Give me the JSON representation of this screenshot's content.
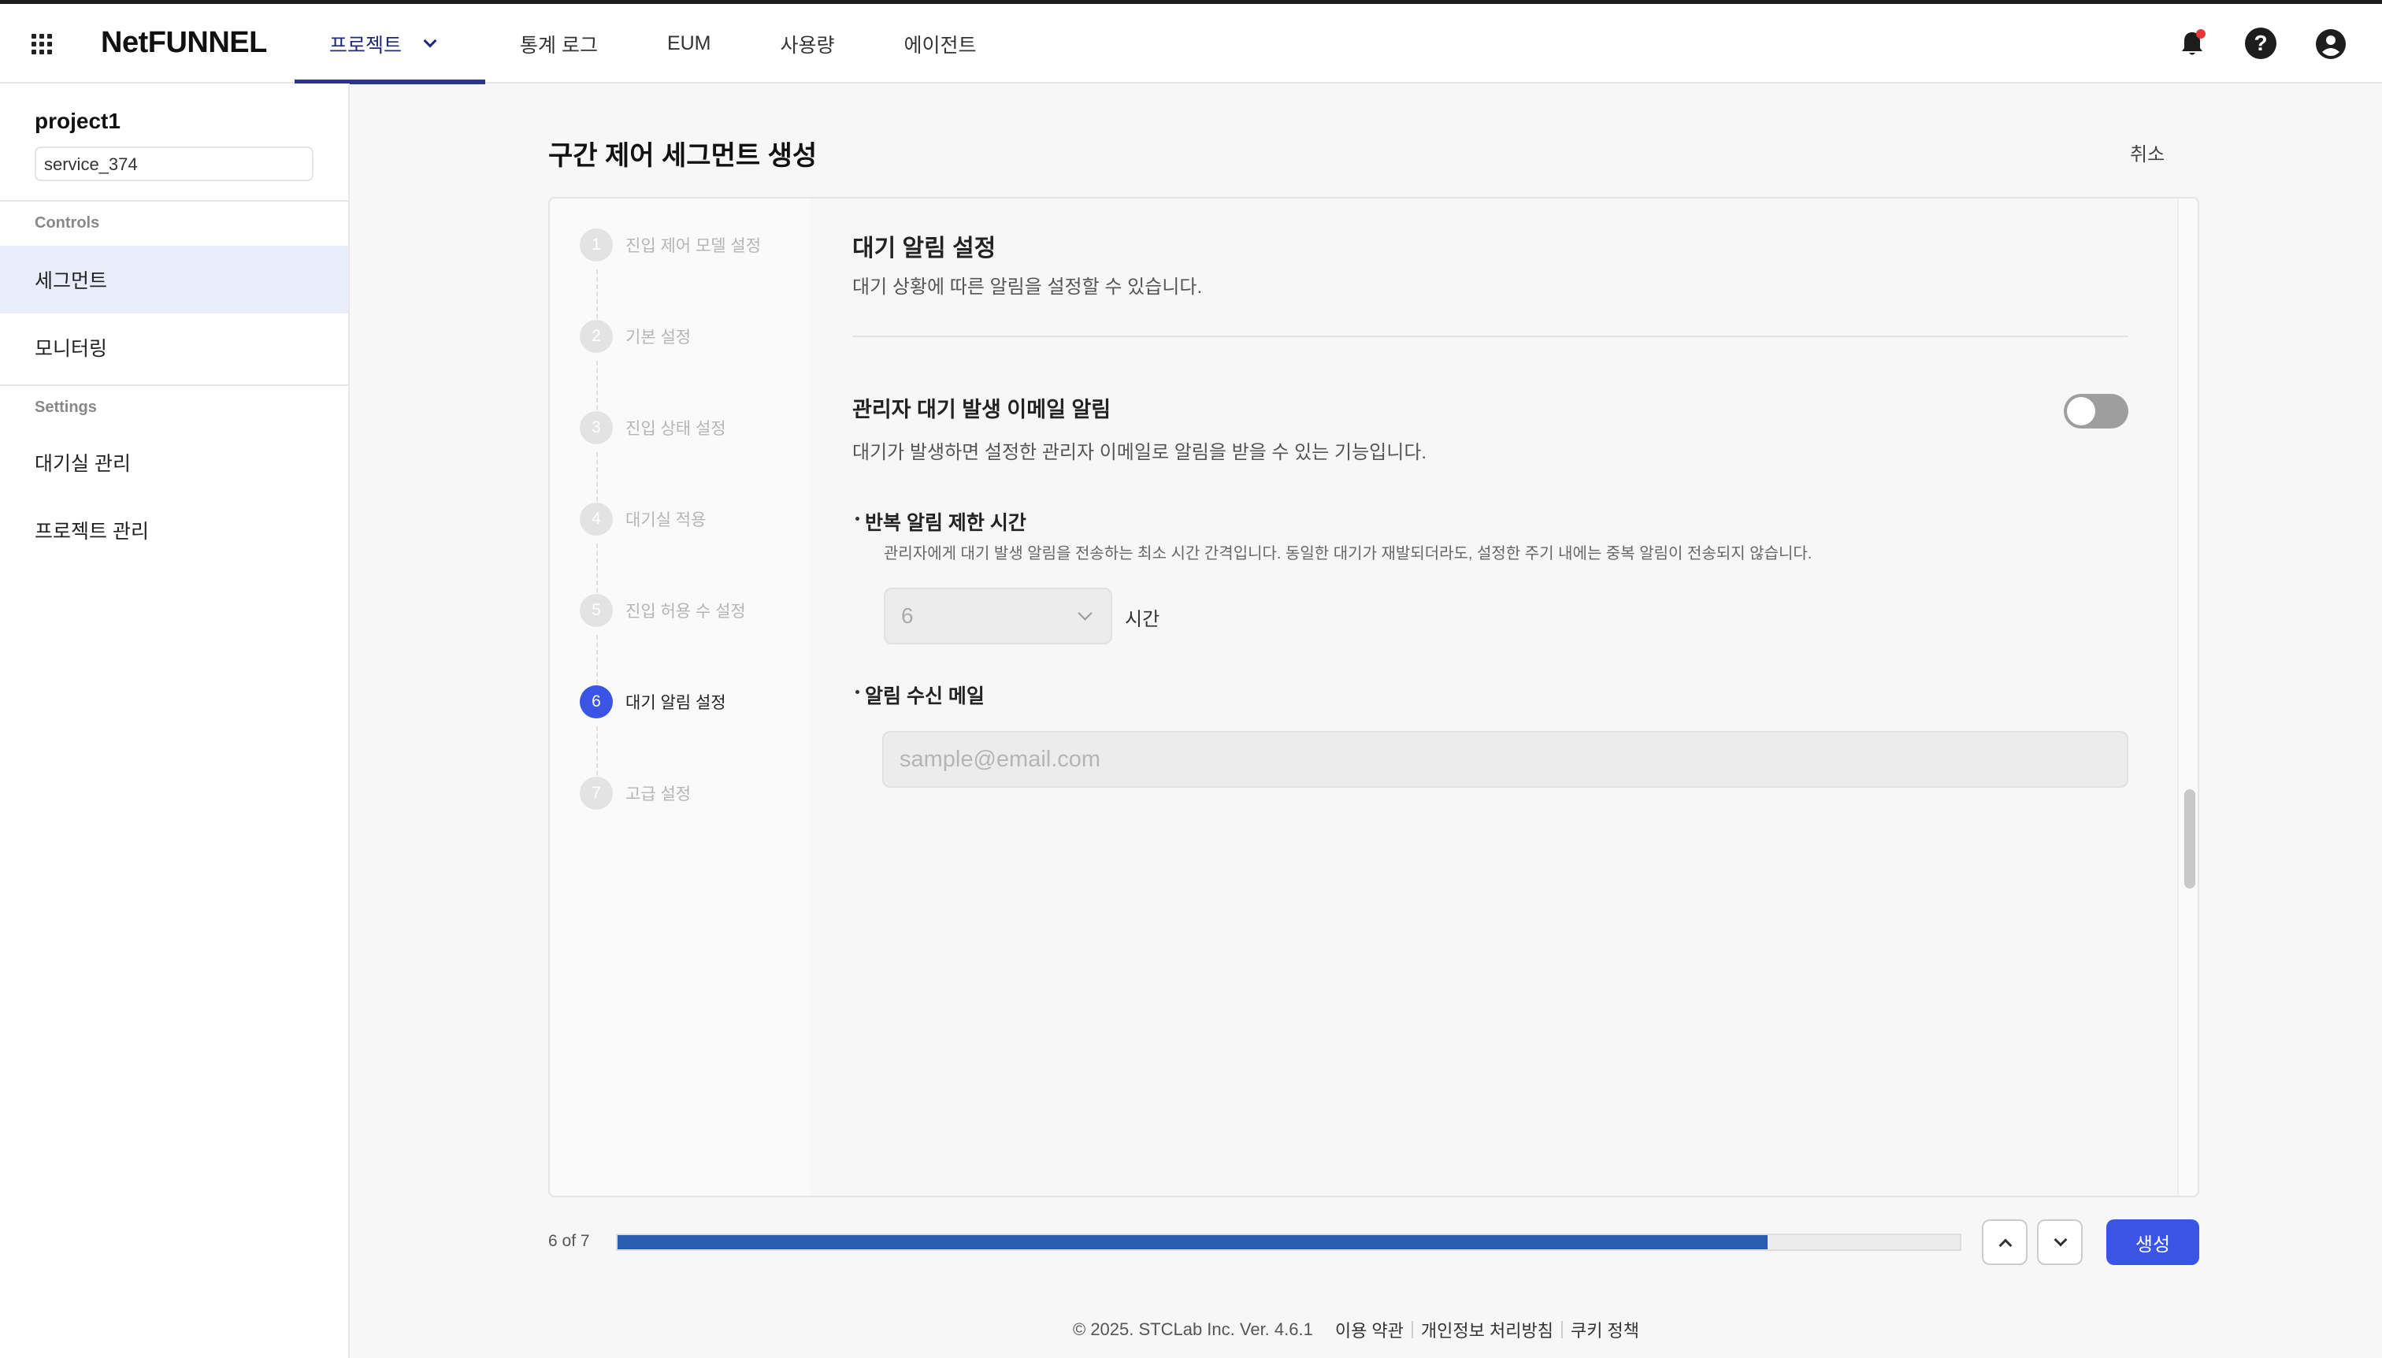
{
  "header": {
    "logo": "NetFUNNEL",
    "nav": [
      "프로젝트",
      "통계 로그",
      "EUM",
      "사용량",
      "에이전트"
    ],
    "active_nav": "프로젝트",
    "icons": [
      "apps-grid-icon",
      "bell-icon",
      "help-icon",
      "account-icon"
    ],
    "help_glyph": "?"
  },
  "sidebar": {
    "project": "project1",
    "service": "service_374",
    "controls_heading": "Controls",
    "controls": [
      "세그먼트",
      "모니터링"
    ],
    "settings_heading": "Settings",
    "settings": [
      "대기실 관리",
      "프로젝트 관리"
    ]
  },
  "page": {
    "title": "구간 제어 세그먼트 생성",
    "cancel": "취소"
  },
  "steps": [
    {
      "num": "1",
      "label": "진입 제어 모델 설정"
    },
    {
      "num": "2",
      "label": "기본 설정"
    },
    {
      "num": "3",
      "label": "진입 상태 설정"
    },
    {
      "num": "4",
      "label": "대기실 적용"
    },
    {
      "num": "5",
      "label": "진입 허용 수 설정"
    },
    {
      "num": "6",
      "label": "대기 알림 설정"
    },
    {
      "num": "7",
      "label": "고급 설정"
    }
  ],
  "active_step": 6,
  "section": {
    "title": "대기 알림 설정",
    "desc": "대기 상황에 따른 알림을 설정할 수 있습니다.",
    "option_title": "관리자 대기 발생 이메일 알림",
    "option_desc": "대기가 발생하면 설정한 관리자 이메일로 알림을 받을 수 있는 기능입니다.",
    "toggle_on": false,
    "repeat_title": "반복 알림 제한 시간",
    "repeat_desc": "관리자에게 대기 발생 알림을 전송하는 최소 시간 간격입니다. 동일한 대기가 재발되더라도, 설정한 주기 내에는 중복 알림이 전송되지 않습니다.",
    "repeat_value": "6",
    "repeat_unit": "시간",
    "mail_title": "알림 수신 메일",
    "mail_placeholder": "sample@email.com"
  },
  "progress": {
    "label": "6 of 7",
    "fraction": 0.857,
    "create": "생성"
  },
  "footer": {
    "copyright": "© 2025. STCLab Inc.  Ver. 4.6.1",
    "links": [
      "이용 약관",
      "개인정보 처리방침",
      "쿠키 정책"
    ]
  }
}
